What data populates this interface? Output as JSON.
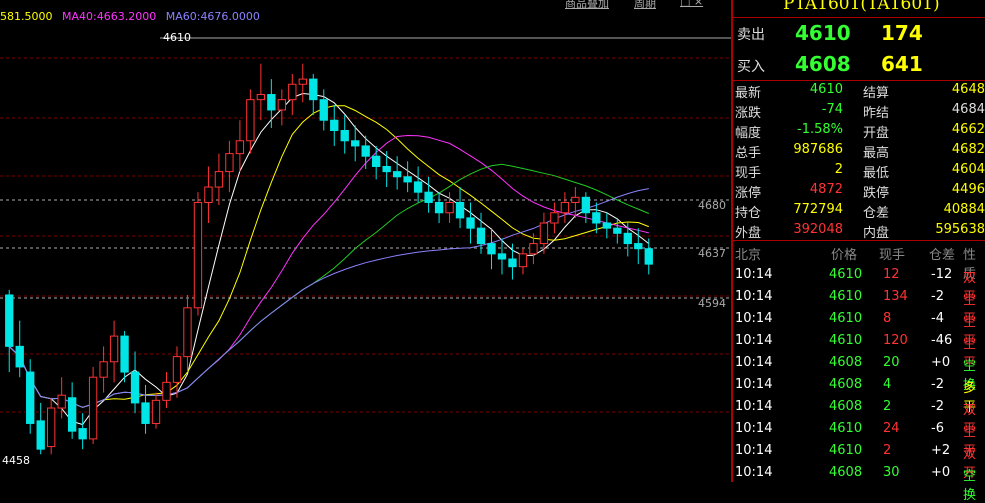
{
  "ma_legend": {
    "ma20": "581.5000",
    "ma40": "MA40:4663.2000",
    "ma60": "MA60:4676.0000"
  },
  "menu": {
    "item1": "商品叠加",
    "item2": "周期",
    "item3": "□ ×"
  },
  "colors": {
    "up": "#ff3333",
    "down": "#00e5e5",
    "ma20": "#ffff00",
    "ma40": "#ff33ff",
    "ma60": "#8a82ff",
    "ma_green": "#22cc22",
    "label_green": "#33ff33",
    "label_red": "#ff3333",
    "label_yellow": "#ffff00"
  },
  "chart_data": {
    "type": "candlestick",
    "price_labels": {
      "high": "4610",
      "low": "4458"
    },
    "right_levels": [
      "4680",
      "4637",
      "4594"
    ],
    "ylim": [
      4455,
      4620
    ],
    "candles": [
      [
        4520,
        4522,
        4500,
        4490
      ],
      [
        4500,
        4510,
        4492,
        4488
      ],
      [
        4490,
        4495,
        4470,
        4466
      ],
      [
        4471,
        4478,
        4460,
        4458
      ],
      [
        4461,
        4480,
        4476,
        4458
      ],
      [
        4476,
        4488,
        4481,
        4472
      ],
      [
        4480,
        4486,
        4467,
        4464
      ],
      [
        4468,
        4474,
        4464,
        4460
      ],
      [
        4464,
        4492,
        4488,
        4462
      ],
      [
        4488,
        4500,
        4494,
        4482
      ],
      [
        4494,
        4510,
        4504,
        4486
      ],
      [
        4504,
        4506,
        4490,
        4486
      ],
      [
        4490,
        4498,
        4478,
        4474
      ],
      [
        4478,
        4485,
        4470,
        4466
      ],
      [
        4470,
        4482,
        4479,
        4468
      ],
      [
        4479,
        4490,
        4486,
        4476
      ],
      [
        4486,
        4500,
        4496,
        4480
      ],
      [
        4496,
        4520,
        4515,
        4490
      ],
      [
        4515,
        4560,
        4556,
        4512
      ],
      [
        4556,
        4570,
        4562,
        4548
      ],
      [
        4562,
        4575,
        4568,
        4555
      ],
      [
        4568,
        4580,
        4575,
        4560
      ],
      [
        4575,
        4588,
        4580,
        4568
      ],
      [
        4580,
        4600,
        4596,
        4575
      ],
      [
        4596,
        4610,
        4598,
        4588
      ],
      [
        4598,
        4604,
        4592,
        4585
      ],
      [
        4592,
        4600,
        4596,
        4586
      ],
      [
        4596,
        4606,
        4602,
        4590
      ],
      [
        4602,
        4610,
        4604,
        4595
      ],
      [
        4604,
        4606,
        4596,
        4590
      ],
      [
        4596,
        4600,
        4588,
        4584
      ],
      [
        4588,
        4594,
        4584,
        4578
      ],
      [
        4584,
        4590,
        4580,
        4575
      ],
      [
        4580,
        4586,
        4578,
        4572
      ],
      [
        4578,
        4582,
        4574,
        4569
      ],
      [
        4574,
        4578,
        4570,
        4565
      ],
      [
        4570,
        4576,
        4568,
        4562
      ],
      [
        4568,
        4574,
        4566,
        4561
      ],
      [
        4566,
        4572,
        4564,
        4560
      ],
      [
        4564,
        4570,
        4560,
        4556
      ],
      [
        4560,
        4566,
        4556,
        4552
      ],
      [
        4556,
        4560,
        4552,
        4548
      ],
      [
        4552,
        4560,
        4556,
        4548
      ],
      [
        4556,
        4562,
        4550,
        4546
      ],
      [
        4550,
        4556,
        4546,
        4540
      ],
      [
        4546,
        4552,
        4540,
        4536
      ],
      [
        4540,
        4546,
        4536,
        4530
      ],
      [
        4536,
        4542,
        4534,
        4528
      ],
      [
        4534,
        4540,
        4531,
        4526
      ],
      [
        4531,
        4538,
        4536,
        4528
      ],
      [
        4536,
        4544,
        4540,
        4532
      ],
      [
        4540,
        4552,
        4548,
        4536
      ],
      [
        4548,
        4556,
        4552,
        4544
      ],
      [
        4552,
        4560,
        4556,
        4548
      ],
      [
        4556,
        4562,
        4558,
        4550
      ],
      [
        4558,
        4560,
        4552,
        4548
      ],
      [
        4552,
        4556,
        4548,
        4544
      ],
      [
        4548,
        4552,
        4546,
        4542
      ],
      [
        4546,
        4550,
        4544,
        4540
      ],
      [
        4544,
        4548,
        4540,
        4535
      ],
      [
        4540,
        4546,
        4538,
        4532
      ],
      [
        4538,
        4542,
        4532,
        4528
      ]
    ]
  },
  "quote": {
    "title": "PTA1601(TA1601)",
    "sell_label": "卖出",
    "sell_price": "4610",
    "sell_vol": "174",
    "buy_label": "买入",
    "buy_price": "4608",
    "buy_vol": "641",
    "fields": [
      {
        "l": "最新",
        "v": "4610",
        "c": "g",
        "l2": "结算",
        "v2": "4648",
        "c2": "y"
      },
      {
        "l": "涨跌",
        "v": "-74",
        "c": "g",
        "l2": "昨结",
        "v2": "4684",
        "c2": "w"
      },
      {
        "l": "幅度",
        "v": "-1.58%",
        "c": "g",
        "l2": "开盘",
        "v2": "4662",
        "c2": "y"
      },
      {
        "l": "总手",
        "v": "987686",
        "c": "y",
        "l2": "最高",
        "v2": "4682",
        "c2": "y"
      },
      {
        "l": "现手",
        "v": "2",
        "c": "y",
        "l2": "最低",
        "v2": "4604",
        "c2": "y"
      },
      {
        "l": "涨停",
        "v": "4872",
        "c": "r",
        "l2": "跌停",
        "v2": "4496",
        "c2": "y"
      },
      {
        "l": "持仓",
        "v": "772794",
        "c": "y",
        "l2": "仓差",
        "v2": "40884",
        "c2": "y"
      },
      {
        "l": "外盘",
        "v": "392048",
        "c": "r",
        "l2": "内盘",
        "v2": "595638",
        "c2": "y"
      }
    ],
    "trade_header": {
      "loc": "北京",
      "price": "价格",
      "vol": "现手",
      "oi": "仓差",
      "type": "性质"
    },
    "trades": [
      {
        "t": "10:14",
        "p": "4610",
        "v": "12",
        "vc": "r",
        "o": "-12",
        "ty": "双平",
        "tc": "r"
      },
      {
        "t": "10:14",
        "p": "4610",
        "v": "134",
        "vc": "r",
        "o": "-2",
        "ty": "空平",
        "tc": "r"
      },
      {
        "t": "10:14",
        "p": "4610",
        "v": "8",
        "vc": "r",
        "o": "-4",
        "ty": "空平",
        "tc": "r"
      },
      {
        "t": "10:14",
        "p": "4610",
        "v": "120",
        "vc": "r",
        "o": "-46",
        "ty": "空平",
        "tc": "r"
      },
      {
        "t": "10:14",
        "p": "4608",
        "v": "20",
        "vc": "g",
        "o": "+0",
        "ty": "空换",
        "tc": "g"
      },
      {
        "t": "10:14",
        "p": "4608",
        "v": "4",
        "vc": "g",
        "o": "-2",
        "ty": "多平",
        "tc": "y"
      },
      {
        "t": "10:14",
        "p": "4608",
        "v": "2",
        "vc": "g",
        "o": "-2",
        "ty": "双平",
        "tc": "r"
      },
      {
        "t": "10:14",
        "p": "4610",
        "v": "24",
        "vc": "r",
        "o": "-6",
        "ty": "空平",
        "tc": "r"
      },
      {
        "t": "10:14",
        "p": "4610",
        "v": "2",
        "vc": "r",
        "o": "+2",
        "ty": "双开",
        "tc": "r"
      },
      {
        "t": "10:14",
        "p": "4608",
        "v": "30",
        "vc": "g",
        "o": "+0",
        "ty": "空换",
        "tc": "g"
      }
    ]
  }
}
